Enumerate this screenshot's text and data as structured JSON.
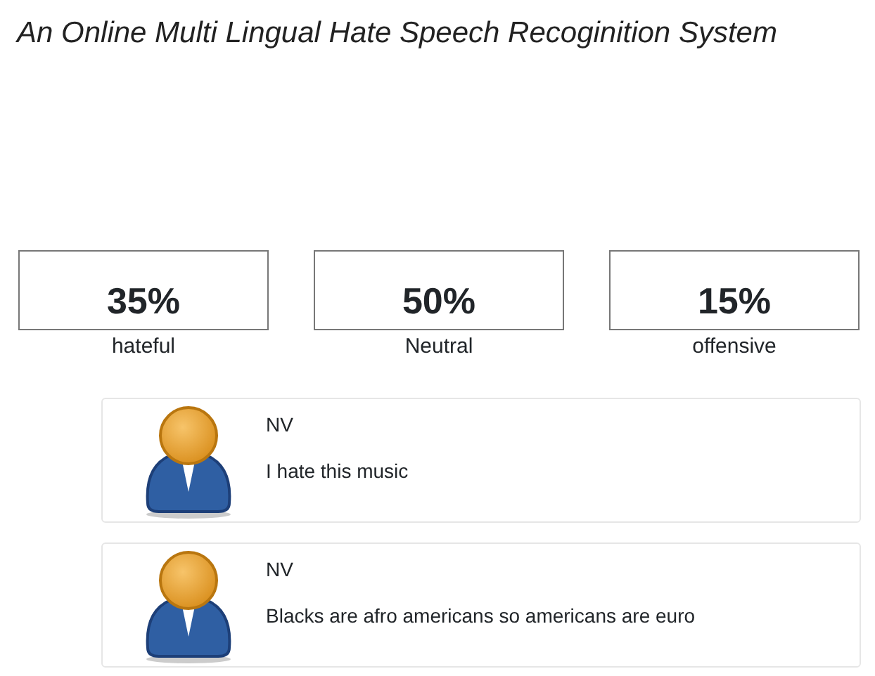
{
  "title": "An Online Multi Lingual Hate Speech Recoginition System",
  "stats": [
    {
      "value": "35%",
      "label": "hateful"
    },
    {
      "value": "50%",
      "label": "Neutral"
    },
    {
      "value": "15%",
      "label": "offensive"
    }
  ],
  "comments": [
    {
      "user": "NV",
      "text": "I hate this music"
    },
    {
      "user": "NV",
      "text": "Blacks are afro americans so americans are euro"
    }
  ]
}
